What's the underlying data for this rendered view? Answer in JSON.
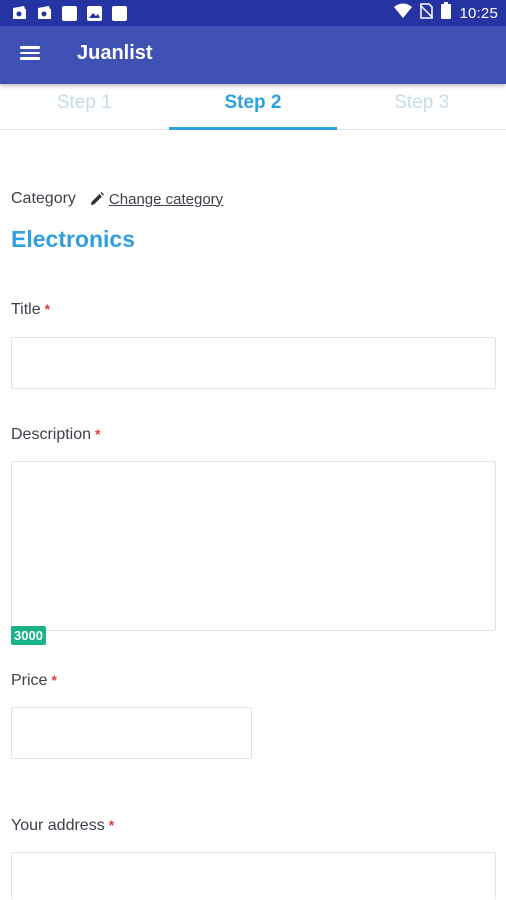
{
  "status_bar": {
    "time": "10:25",
    "left_icons": [
      "wallet-icon",
      "wallet-icon",
      "notification-square-icon",
      "image-icon",
      "notification-square-icon"
    ],
    "right_icons": [
      "wifi-icon",
      "no-sim-icon",
      "battery-icon"
    ]
  },
  "app_bar": {
    "title": "Juanlist",
    "menu_icon": "menu-icon"
  },
  "tabs": [
    {
      "label": "Step 1",
      "active": false
    },
    {
      "label": "Step 2",
      "active": true
    },
    {
      "label": "Step 3",
      "active": false
    }
  ],
  "form": {
    "category_label": "Category",
    "change_category": "Change category",
    "category_value": "Electronics",
    "title_label": "Title",
    "title_value": "",
    "description_label": "Description",
    "description_value": "",
    "char_counter": "3000",
    "price_label": "Price",
    "price_value": "",
    "address_label": "Your address",
    "address_value": "",
    "required_marker": "*"
  },
  "colors": {
    "status_bar": "#2533a3",
    "app_bar": "#3f51b5",
    "accent": "#2e9fe0",
    "required": "#e53935",
    "counter": "#19b38a"
  }
}
